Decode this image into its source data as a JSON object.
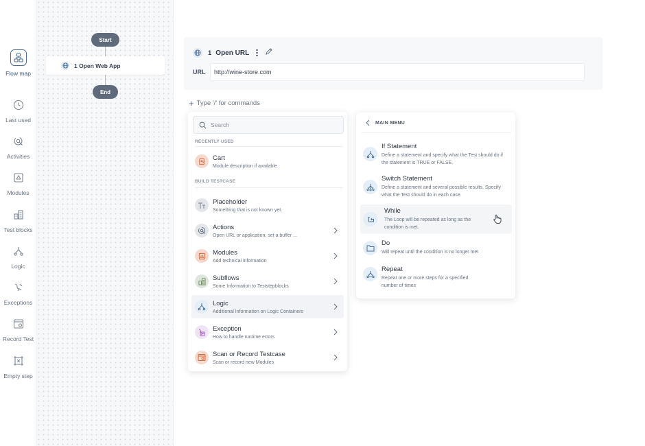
{
  "nav": {
    "items": [
      {
        "label": "Flow map",
        "icon": "flow-map-icon",
        "active": true
      },
      {
        "label": "Last used",
        "icon": "clock-icon"
      },
      {
        "label": "Activities",
        "icon": "activities-icon"
      },
      {
        "label": "Modules",
        "icon": "modules-icon"
      },
      {
        "label": "Test blocks",
        "icon": "test-blocks-icon"
      },
      {
        "label": "Logic",
        "icon": "logic-icon"
      },
      {
        "label": "Exceptions",
        "icon": "exceptions-icon"
      },
      {
        "label": "Record Test",
        "icon": "record-icon"
      },
      {
        "label": "Empty step",
        "icon": "empty-step-icon"
      }
    ]
  },
  "flow": {
    "start_label": "Start",
    "node_label": "1 Open Web App",
    "end_label": "End"
  },
  "step": {
    "number": "1",
    "title": "Open URL",
    "url_label": "URL",
    "url_value": "http://wine-store.com"
  },
  "command_hint": "Type '/' for commands",
  "menu": {
    "search_placeholder": "Search",
    "recently_used_title": "RECENTLY USED",
    "build_title": "BUILD TESTCASE",
    "recent": [
      {
        "title": "Cart",
        "desc": "Module description if available"
      }
    ],
    "items": [
      {
        "title": "Placeholder",
        "desc": "Something that is not known yet."
      },
      {
        "title": "Actions",
        "desc": "Open URL or application, set a buffer ..."
      },
      {
        "title": "Modules",
        "desc": "Add technical information"
      },
      {
        "title": "Subflows",
        "desc": "Some  Information to Teststepblocks"
      },
      {
        "title": "Logic",
        "desc": "Additional Information on Logic Containers"
      },
      {
        "title": "Exception",
        "desc": "How to handle runtime errors"
      },
      {
        "title": "Scan or Record Testcase",
        "desc": "Scan or record new Modules"
      }
    ]
  },
  "submenu": {
    "back_label": "MAIN MENU",
    "items": [
      {
        "title": "If Statement",
        "desc": "Define a statement and specify what the Test should do if the statement is TRUE or FALSE."
      },
      {
        "title": "Switch Statement",
        "desc": "Define a statement and several possible results. Specify what the Test should do in each case."
      },
      {
        "title": "While",
        "desc": "The Loop will be repeated as long as the condition is met."
      },
      {
        "title": "Do",
        "desc": "Will repeat until the condition is no longer met"
      },
      {
        "title": "Repeat",
        "desc": "Repeat one or more steps for a specified number of times"
      }
    ]
  },
  "colors": {
    "accent": "#3d5c80",
    "flow_pill": "#5f6b7a",
    "logic_icon_bg": "#e4eef7",
    "orange_icon_bg": "#f6d9cc",
    "gray_icon_bg": "#e3e5e9",
    "green_icon_bg": "#dfe7dc",
    "purple_icon_bg": "#efe3f5"
  }
}
